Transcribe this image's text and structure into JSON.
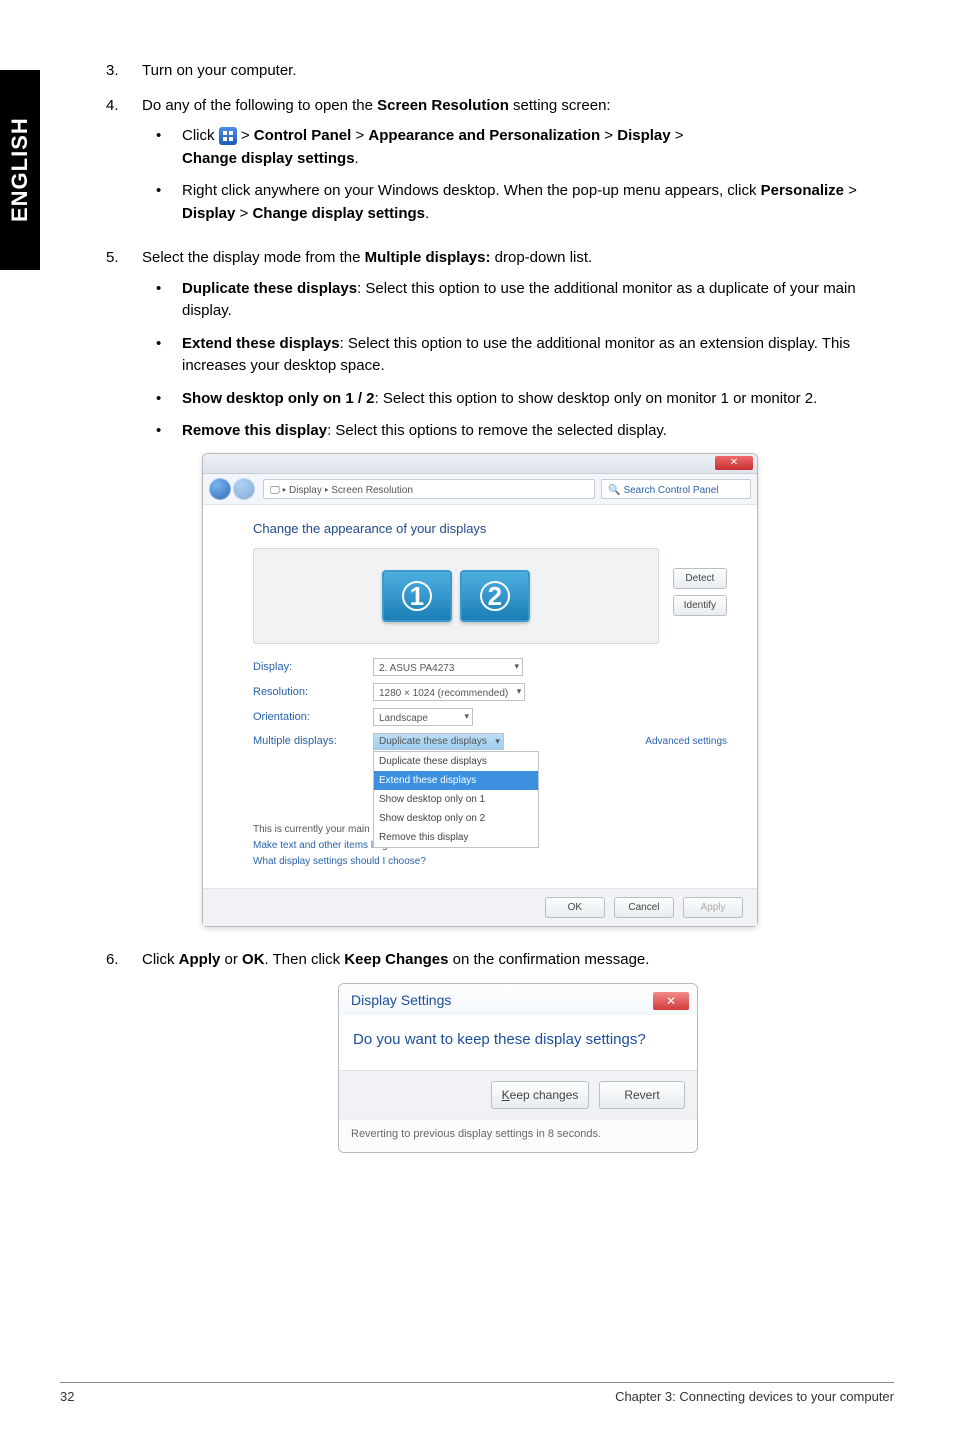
{
  "sidetab": "ENGLISH",
  "steps": {
    "s3": {
      "num": "3.",
      "text": "Turn on your computer."
    },
    "s4": {
      "num": "4.",
      "text_a": "Do any of the following to open the ",
      "bold1": "Screen Resolution",
      "text_b": " setting screen:",
      "b1": {
        "pre": "Click ",
        "mid": " > ",
        "b1": "Control Panel",
        "b2": "Appearance and Personalization",
        "b3": "Display",
        "b4": "Change display settings",
        "post": "."
      },
      "b2": {
        "line1": "Right click anywhere on your Windows desktop. When the pop-up menu appears, click ",
        "b1": "Personalize",
        "gt1": " > ",
        "b2": "Display",
        "gt2": " > ",
        "b3": "Change display settings",
        "post": "."
      }
    },
    "s5": {
      "num": "5.",
      "text_a": "Select the display mode from the ",
      "bold1": "Multiple displays:",
      "text_b": " drop-down list.",
      "i1": {
        "b": "Duplicate these displays",
        "t": ": Select this option to use the additional monitor as a duplicate of your main display."
      },
      "i2": {
        "b": "Extend these displays",
        "t": ": Select this option to use the additional monitor as an extension display. This increases your desktop space."
      },
      "i3": {
        "b": "Show desktop only on 1 / 2",
        "t": ": Select this option to show desktop only on monitor 1 or monitor 2."
      },
      "i4": {
        "b": "Remove this display",
        "t": ": Select this options to remove the selected display."
      }
    },
    "s6": {
      "num": "6.",
      "t1": "Click ",
      "b1": "Apply",
      "t2": " or ",
      "b2": "OK",
      "t3": ". Then click ",
      "b3": "Keep Changes",
      "t4": " on the confirmation message."
    }
  },
  "dlg1": {
    "crumb_icon": "🖵",
    "crumb": " ▸ Display ▸ Screen Resolution",
    "search_glyph": "🔍",
    "search": "Search Control Panel",
    "heading": "Change the appearance of your displays",
    "mon1": "1",
    "mon2": "2",
    "detect": "Detect",
    "identify": "Identify",
    "lbl_display": "Display:",
    "val_display": "2. ASUS PA4273",
    "lbl_res": "Resolution:",
    "val_res": "1280 × 1024 (recommended)",
    "lbl_orient": "Orientation:",
    "val_orient": "Landscape",
    "lbl_multi": "Multiple displays:",
    "val_multi": "Duplicate these displays",
    "opt1": "Duplicate these displays",
    "opt2": "Extend these displays",
    "opt3": "Show desktop only on 1",
    "opt4": "Show desktop only on 2",
    "opt5": "Remove this display",
    "main_note": "This is currently your main display.",
    "adv": "Advanced settings",
    "link1": "Make text and other items larger or smaller",
    "link2": "What display settings should I choose?",
    "ok": "OK",
    "cancel": "Cancel",
    "apply": "Apply"
  },
  "dlg2": {
    "title": "Display Settings",
    "close": "✕",
    "question": "Do you want to keep these display settings?",
    "keep_underline": "K",
    "keep_rest": "eep changes",
    "revert": "Revert",
    "foot": "Reverting to previous display settings in 8 seconds."
  },
  "footer": {
    "pg": "32",
    "chap": "Chapter 3: Connecting devices to your computer"
  }
}
